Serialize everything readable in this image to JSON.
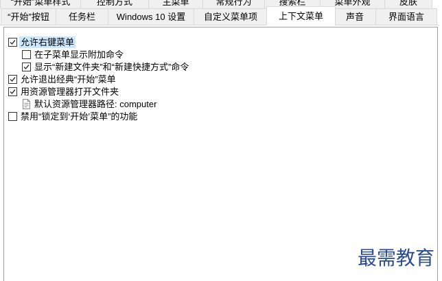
{
  "tabs": {
    "row_top": [
      {
        "label": "“开始”菜单样式",
        "selected": false
      },
      {
        "label": "控制方式",
        "selected": false
      },
      {
        "label": "主菜单",
        "selected": false
      },
      {
        "label": "常规行为",
        "selected": false
      },
      {
        "label": "搜索栏",
        "selected": false
      },
      {
        "label": "菜单外观",
        "selected": false
      },
      {
        "label": "皮肤",
        "selected": false
      }
    ],
    "row_bottom": [
      {
        "label": "“开始”按钮",
        "selected": false
      },
      {
        "label": "任务栏",
        "selected": false
      },
      {
        "label": "Windows 10 设置",
        "selected": false
      },
      {
        "label": "自定义菜单项",
        "selected": false
      },
      {
        "label": "上下文菜单",
        "selected": true
      },
      {
        "label": "声音",
        "selected": false
      },
      {
        "label": "界面语言",
        "selected": false
      }
    ]
  },
  "settings": [
    {
      "label": "允许右键菜单",
      "checked": true,
      "highlighted": true,
      "children": [
        {
          "label": "在子菜单显示附加命令",
          "checked": false
        },
        {
          "label": "显示“新建文件夹”和“新建快捷方式”命令",
          "checked": true
        }
      ]
    },
    {
      "label": "允许退出经典“开始”菜单",
      "checked": true
    },
    {
      "label": "用资源管理器打开文件夹",
      "checked": true,
      "children": [
        {
          "label": "默认资源管理器路径: computer",
          "icon": "text-setting-icon"
        }
      ]
    },
    {
      "label": "禁用“锁定到‘开始’菜单”的功能",
      "checked": false
    }
  ],
  "watermark": {
    "text": "最需教育"
  },
  "colors": {
    "selection_highlight": "#cce8ff",
    "tab_background": "#f0f0f0",
    "tab_selected_background": "#ffffff",
    "tab_border": "#d9d9d9",
    "list_border": "#a0a0a0",
    "checkbox_border": "#333333",
    "watermark": "#2a4a9a"
  }
}
